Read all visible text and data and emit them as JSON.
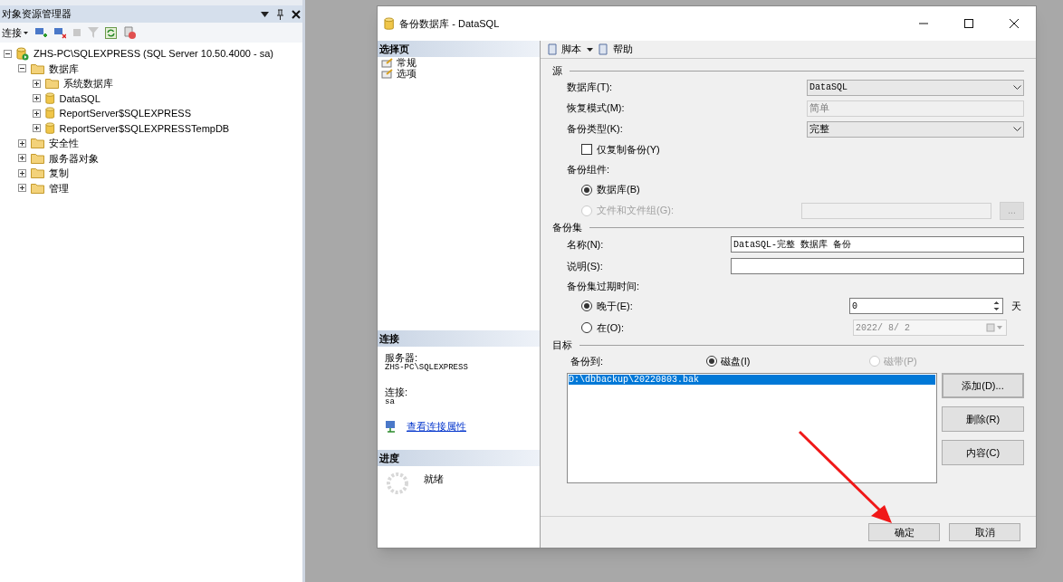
{
  "explorer": {
    "title": "对象资源管理器",
    "connect_label": "连接",
    "tree": [
      {
        "label": "ZHS-PC\\SQLEXPRESS (SQL Server 10.50.4000 - sa)",
        "kind": "server",
        "expanded": true,
        "children": [
          {
            "label": "数据库",
            "kind": "folder",
            "expanded": true,
            "children": [
              {
                "label": "系统数据库",
                "kind": "folder",
                "expanded": false
              },
              {
                "label": "DataSQL",
                "kind": "database",
                "expanded": false
              },
              {
                "label": "ReportServer$SQLEXPRESS",
                "kind": "database",
                "expanded": false
              },
              {
                "label": "ReportServer$SQLEXPRESSTempDB",
                "kind": "database",
                "expanded": false
              }
            ]
          },
          {
            "label": "安全性",
            "kind": "folder",
            "expanded": false
          },
          {
            "label": "服务器对象",
            "kind": "folder",
            "expanded": false
          },
          {
            "label": "复制",
            "kind": "folder",
            "expanded": false
          },
          {
            "label": "管理",
            "kind": "folder",
            "expanded": false
          }
        ]
      }
    ]
  },
  "dialog": {
    "title": "备份数据库 - DataSQL",
    "sidebar": {
      "heading": "选择页",
      "pages": [
        "常规",
        "选项"
      ]
    },
    "connection": {
      "heading": "连接",
      "server_label": "服务器:",
      "server": "ZHS-PC\\SQLEXPRESS",
      "login_label": "连接:",
      "login": "sa",
      "link": "查看连接属性"
    },
    "progress": {
      "heading": "进度",
      "status": "就绪"
    },
    "toolbar": {
      "script": "脚本",
      "help": "帮助"
    },
    "source": {
      "heading": "源",
      "database": {
        "label": "数据库(T):",
        "value": "DataSQL"
      },
      "recovery_model": {
        "label": "恢复模式(M):",
        "value": "简单"
      },
      "backup_type": {
        "label": "备份类型(K):",
        "value": "完整"
      },
      "copy_only": {
        "label": "仅复制备份(Y)",
        "checked": false
      },
      "component_label": "备份组件:",
      "components": [
        {
          "label": "数据库(B)",
          "selected": true,
          "disabled": false
        },
        {
          "label": "文件和文件组(G):",
          "selected": false,
          "disabled": true
        }
      ],
      "browse": "..."
    },
    "backup_set": {
      "heading": "备份集",
      "name": {
        "label": "名称(N):",
        "value": "DataSQL-完整 数据库 备份"
      },
      "description": {
        "label": "说明(S):"
      },
      "expiry_label": "备份集过期时间:",
      "expiry": [
        {
          "label": "晚于(E):",
          "selected": true,
          "value": "0",
          "unit": "天"
        },
        {
          "label": "在(O):",
          "selected": false,
          "value": "2022/ 8/ 2"
        }
      ]
    },
    "destination": {
      "heading": "目标",
      "backup_to_label": "备份到:",
      "media": [
        {
          "label": "磁盘(I)",
          "selected": true,
          "disabled": false
        },
        {
          "label": "磁带(P)",
          "selected": false,
          "disabled": true
        }
      ],
      "files": [
        {
          "path": "D:\\dbbackup\\20220803.bak",
          "selected": true
        }
      ],
      "buttons": [
        "添加(D)...",
        "删除(R)",
        "内容(C)"
      ]
    },
    "footer": [
      "确定",
      "取消"
    ]
  }
}
